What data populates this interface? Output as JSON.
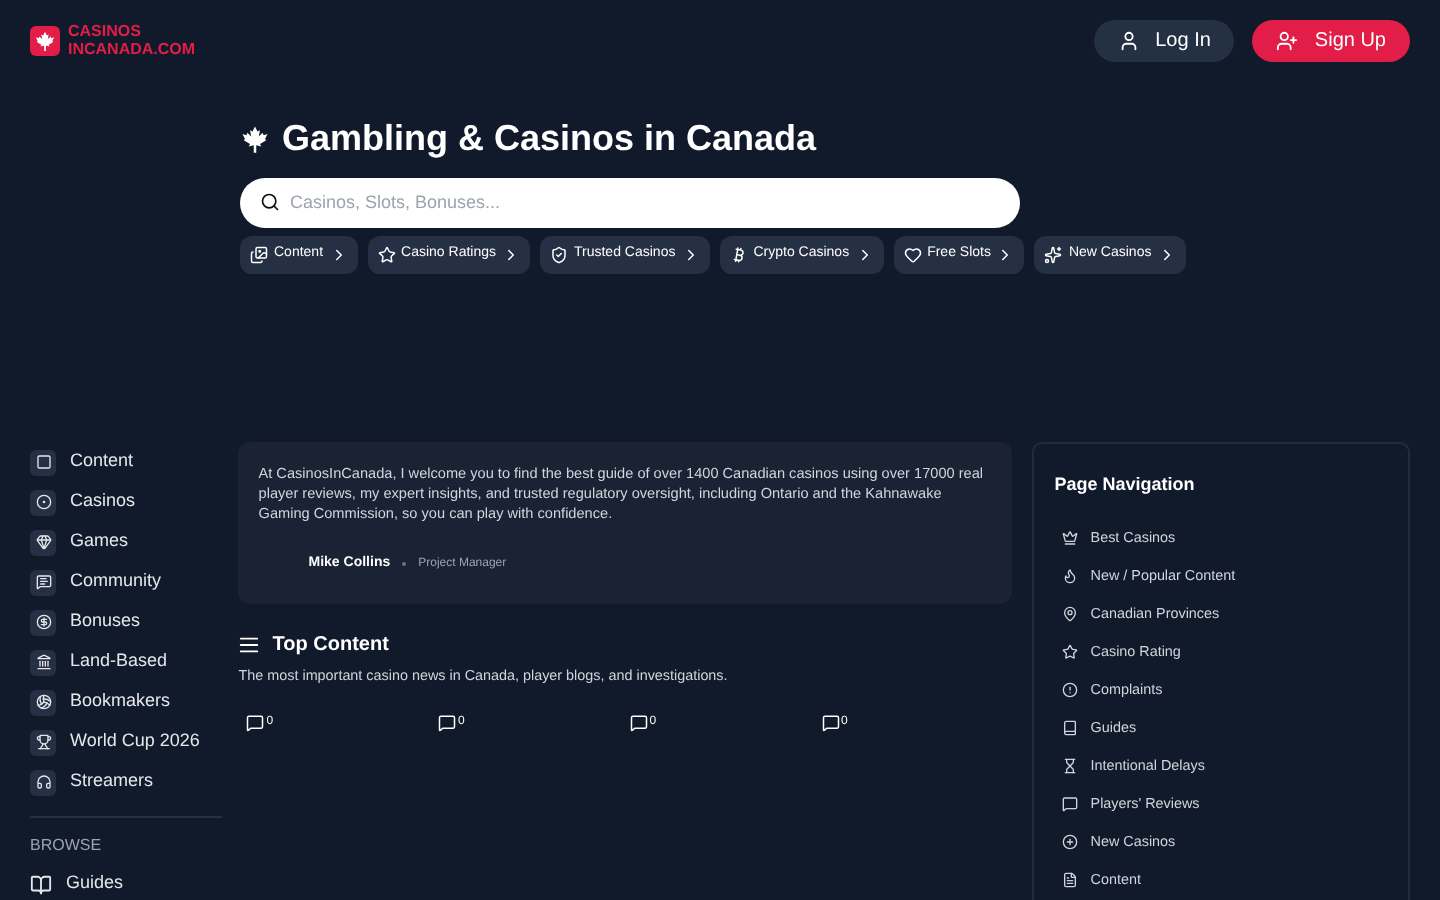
{
  "logo": {
    "line1": "CASINOS",
    "line2": "INCANADA.COM"
  },
  "header": {
    "login": "Log In",
    "signup": "Sign Up"
  },
  "hero": {
    "title": "Gambling & Casinos in Canada",
    "search": {
      "placeholder": "Casinos, Slots, Bonuses..."
    },
    "chips": [
      {
        "label": "Content"
      },
      {
        "label": "Casino Ratings"
      },
      {
        "label": "Trusted Casinos"
      },
      {
        "label": "Crypto Casinos"
      },
      {
        "label": "Free Slots"
      },
      {
        "label": "New Casinos"
      }
    ]
  },
  "sidebar": {
    "items": [
      {
        "label": "Content"
      },
      {
        "label": "Casinos"
      },
      {
        "label": "Games"
      },
      {
        "label": "Community"
      },
      {
        "label": "Bonuses"
      },
      {
        "label": "Land-Based"
      },
      {
        "label": "Bookmakers"
      },
      {
        "label": "World Cup 2026"
      },
      {
        "label": "Streamers"
      }
    ],
    "browse": {
      "heading": "BROWSE",
      "items": [
        {
          "label": "Guides"
        }
      ]
    }
  },
  "intro": {
    "text": "At CasinosInCanada, I welcome you to find the best guide of over 1400 Canadian casinos using over 17000 real player reviews, my expert insights, and trusted regulatory oversight, including Ontario and the Kahnawake Gaming Commission, so you can play with confidence.",
    "author": "Mike Collins",
    "role": "Project Manager"
  },
  "top_content": {
    "title": "Top Content",
    "subtitle": "The most important casino news in Canada, player blogs, and investigations.",
    "posts": [
      {
        "comments": "0"
      },
      {
        "comments": "0"
      },
      {
        "comments": "0"
      },
      {
        "comments": "0"
      }
    ]
  },
  "page_navigation": {
    "title": "Page Navigation",
    "items": [
      {
        "label": "Best Casinos"
      },
      {
        "label": "New / Popular Content"
      },
      {
        "label": "Canadian Provinces"
      },
      {
        "label": "Casino Rating"
      },
      {
        "label": "Complaints"
      },
      {
        "label": "Guides"
      },
      {
        "label": "Intentional Delays"
      },
      {
        "label": "Players' Reviews"
      },
      {
        "label": "New Casinos"
      },
      {
        "label": "Content"
      }
    ]
  }
}
